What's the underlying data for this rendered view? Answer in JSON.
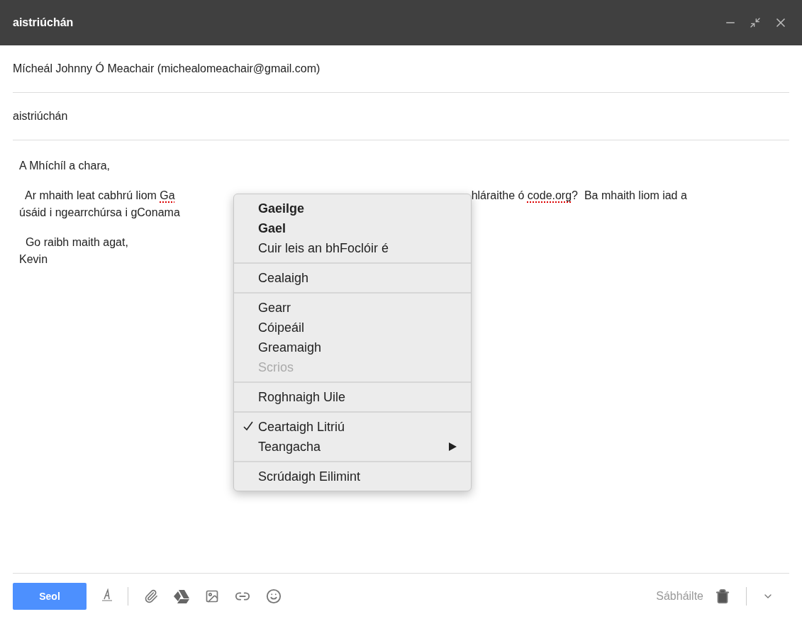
{
  "window": {
    "title": "aistriúchán"
  },
  "from": "Mícheál Johnny Ó Meachair (michealomeachair@gmail.com)",
  "subject": "aistriúchán",
  "body": [
    {
      "segments": [
        {
          "text": "A Mhíchíl a chara,",
          "misspelled": false
        }
      ]
    },
    {
      "space_before": true,
      "segments": [
        {
          "text": "  Ar mhaith leat cabhrú liom ",
          "misspelled": false
        },
        {
          "text": "Ga",
          "misspelled": true
        }
      ],
      "right": [
        {
          "text": "hláraithe ó ",
          "misspelled": false
        },
        {
          "text": "code.org",
          "misspelled": true
        },
        {
          "text": "?  Ba mhaith liom iad a",
          "misspelled": false
        }
      ]
    },
    {
      "segments": [
        {
          "text": "úsáid i ngearrchúrsa i gConama",
          "misspelled": false
        }
      ]
    },
    {
      "space_before": true,
      "segments": [
        {
          "text": "  Go raibh maith agat,",
          "misspelled": false
        }
      ]
    },
    {
      "segments": [
        {
          "text": "Kevin",
          "misspelled": false
        }
      ]
    }
  ],
  "context_menu": {
    "groups": [
      [
        {
          "label": "Gaeilge",
          "bold": true,
          "disabled": false,
          "checked": false,
          "submenu": false
        },
        {
          "label": "Gael",
          "bold": true,
          "disabled": false,
          "checked": false,
          "submenu": false
        },
        {
          "label": "Cuir leis an bhFoclóir é",
          "bold": false,
          "disabled": false,
          "checked": false,
          "submenu": false
        }
      ],
      [
        {
          "label": "Cealaigh",
          "bold": false,
          "disabled": false,
          "checked": false,
          "submenu": false
        }
      ],
      [
        {
          "label": "Gearr",
          "bold": false,
          "disabled": false,
          "checked": false,
          "submenu": false
        },
        {
          "label": "Cóipeáil",
          "bold": false,
          "disabled": false,
          "checked": false,
          "submenu": false
        },
        {
          "label": "Greamaigh",
          "bold": false,
          "disabled": false,
          "checked": false,
          "submenu": false
        },
        {
          "label": "Scrios",
          "bold": false,
          "disabled": true,
          "checked": false,
          "submenu": false
        }
      ],
      [
        {
          "label": "Roghnaigh Uile",
          "bold": false,
          "disabled": false,
          "checked": false,
          "submenu": false
        }
      ],
      [
        {
          "label": "Ceartaigh Litriú",
          "bold": false,
          "disabled": false,
          "checked": true,
          "submenu": false
        },
        {
          "label": "Teangacha",
          "bold": false,
          "disabled": false,
          "checked": false,
          "submenu": true
        }
      ],
      [
        {
          "label": "Scrúdaigh Eilimint",
          "bold": false,
          "disabled": false,
          "checked": false,
          "submenu": false
        }
      ]
    ]
  },
  "toolbar": {
    "send": "Seol",
    "status": "Sábháilte"
  }
}
